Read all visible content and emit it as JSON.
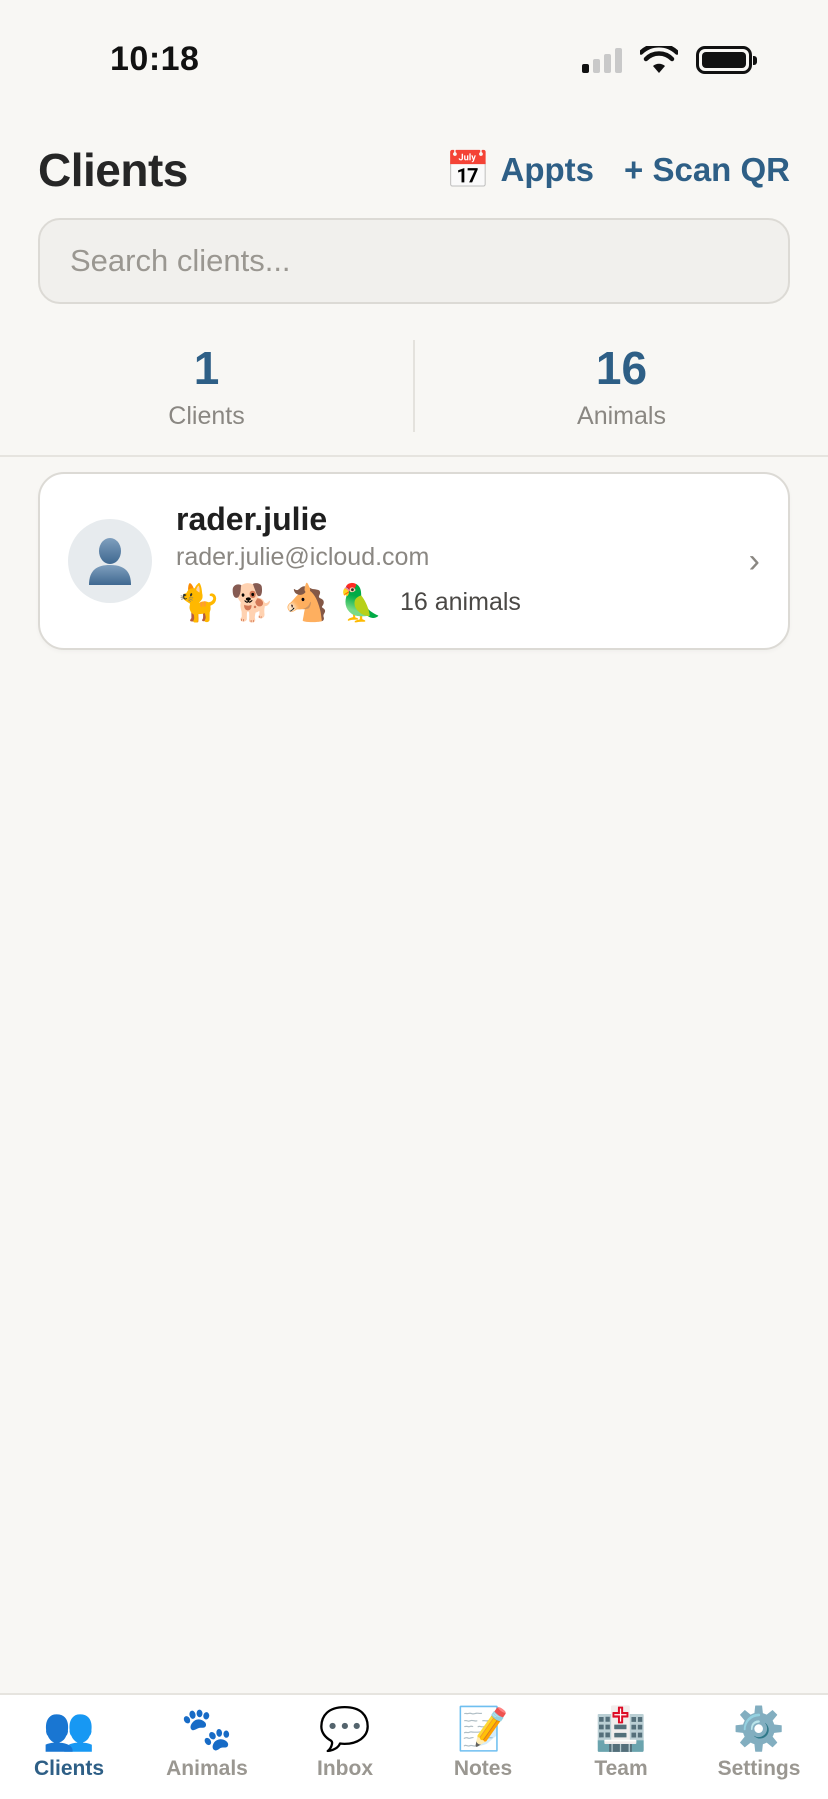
{
  "status_bar": {
    "time": "10:18"
  },
  "header": {
    "title": "Clients",
    "appts_icon": "📅",
    "appts_label": "Appts",
    "scan_label": "+ Scan QR"
  },
  "search": {
    "placeholder": "Search clients..."
  },
  "stats": [
    {
      "value": "1",
      "label": "Clients"
    },
    {
      "value": "16",
      "label": "Animals"
    }
  ],
  "clients": [
    {
      "name": "rader.julie",
      "email": "rader.julie@icloud.com",
      "animal_icons": [
        "🐈",
        "🐕",
        "🐴",
        "🦜"
      ],
      "animal_count": "16 animals"
    }
  ],
  "tabs": [
    {
      "icon": "👥",
      "label": "Clients",
      "active": true
    },
    {
      "icon": "🐾",
      "label": "Animals"
    },
    {
      "icon": "💬",
      "label": "Inbox"
    },
    {
      "icon": "📝",
      "label": "Notes"
    },
    {
      "icon": "🏥",
      "label": "Team"
    },
    {
      "icon": "⚙️",
      "label": "Settings"
    }
  ],
  "colors": {
    "accent": "#2e5f86",
    "background": "#f8f7f4",
    "card": "#ffffff",
    "muted_text": "#8a8782"
  }
}
